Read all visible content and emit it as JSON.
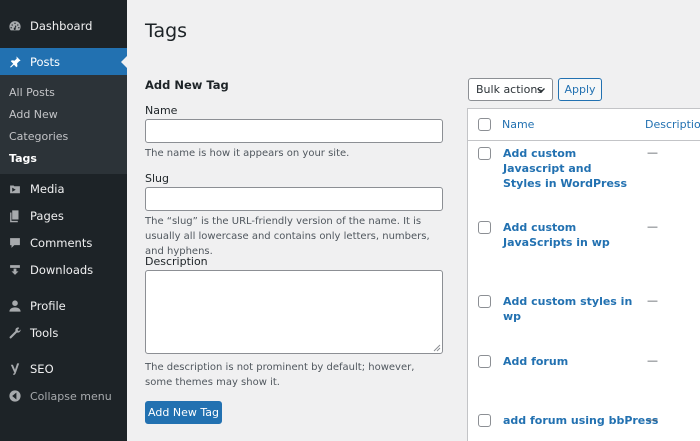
{
  "sidebar": {
    "items": [
      {
        "label": "Dashboard",
        "icon": "dashboard-icon"
      },
      {
        "label": "Posts",
        "icon": "pushpin-icon"
      },
      {
        "label": "Media",
        "icon": "media-icon"
      },
      {
        "label": "Pages",
        "icon": "pages-icon"
      },
      {
        "label": "Comments",
        "icon": "comment-icon"
      },
      {
        "label": "Downloads",
        "icon": "download-icon"
      },
      {
        "label": "Profile",
        "icon": "user-icon"
      },
      {
        "label": "Tools",
        "icon": "wrench-icon"
      },
      {
        "label": "SEO",
        "icon": "yoast-icon"
      }
    ],
    "submenu": [
      "All Posts",
      "Add New",
      "Categories",
      "Tags"
    ],
    "collapse_label": "Collapse menu"
  },
  "page": {
    "title": "Tags"
  },
  "form": {
    "title": "Add New Tag",
    "name_label": "Name",
    "name_value": "",
    "name_help": "The name is how it appears on your site.",
    "slug_label": "Slug",
    "slug_value": "",
    "slug_help": "The “slug” is the URL-friendly version of the name. It is usually all lowercase and contains only letters, numbers, and hyphens.",
    "description_label": "Description",
    "description_value": "",
    "description_help": "The description is not prominent by default; however, some themes may show it.",
    "submit_label": "Add New Tag"
  },
  "table": {
    "bulk_actions": "Bulk actions",
    "apply_label": "Apply",
    "columns": [
      "Name",
      "Description"
    ],
    "rows": [
      {
        "name": "Add custom Javascript and Styles in WordPress",
        "description": "—"
      },
      {
        "name": "Add custom JavaScripts in wp",
        "description": "—"
      },
      {
        "name": "Add custom styles in wp",
        "description": "—"
      },
      {
        "name": "Add forum",
        "description": "—"
      },
      {
        "name": "add forum using bbPress",
        "description": "—"
      }
    ]
  },
  "colors": {
    "sidebar_bg": "#1d2327",
    "accent": "#2271b1",
    "page_bg": "#f0f0f1"
  }
}
